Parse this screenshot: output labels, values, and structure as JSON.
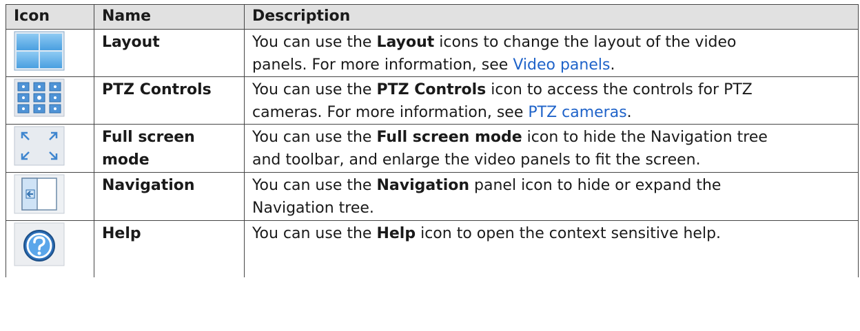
{
  "headers": {
    "icon": "Icon",
    "name": "Name",
    "description": "Description"
  },
  "rows": [
    {
      "icon": "layout-grid-icon",
      "name_line1": "Layout",
      "name_line2": "",
      "desc_pre": "You can use the ",
      "desc_kw": "Layout",
      "desc_mid": " icons to change the layout of the video",
      "desc_line2": "panels. For more information, see ",
      "desc_link": "Video panels",
      "desc_post": "."
    },
    {
      "icon": "ptz-controls-icon",
      "name_line1": "PTZ Controls",
      "name_line2": "",
      "desc_pre": "You can use the ",
      "desc_kw": "PTZ Controls",
      "desc_mid": " icon to access the controls for PTZ",
      "desc_line2": "cameras. For more information, see ",
      "desc_link": "PTZ cameras",
      "desc_post": "."
    },
    {
      "icon": "full-screen-icon",
      "name_line1": "Full screen",
      "name_line2": "mode",
      "desc_pre": "You can use the ",
      "desc_kw": "Full screen mode",
      "desc_mid": " icon to hide the Navigation tree",
      "desc_line2": "and toolbar, and enlarge the video panels to fit the screen.",
      "desc_link": "",
      "desc_post": ""
    },
    {
      "icon": "navigation-panel-icon",
      "name_line1": "Navigation",
      "name_line2": "",
      "desc_pre": "You can use the ",
      "desc_kw": "Navigation",
      "desc_mid": " panel icon to hide or expand the",
      "desc_line2": "Navigation tree.",
      "desc_link": "",
      "desc_post": ""
    },
    {
      "icon": "help-icon",
      "name_line1": "Help",
      "name_line2": "",
      "desc_pre": "You can use the ",
      "desc_kw": "Help",
      "desc_mid": " icon to open the context sensitive help.",
      "desc_line2": "",
      "desc_link": "",
      "desc_post": ""
    }
  ]
}
